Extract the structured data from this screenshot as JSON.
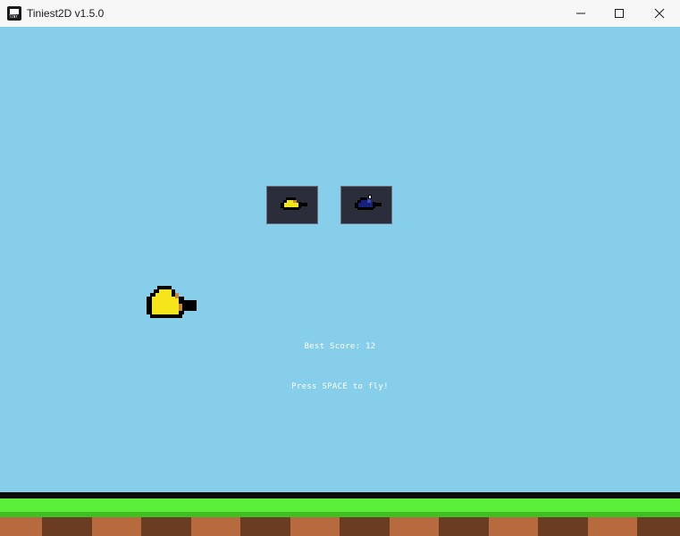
{
  "window": {
    "title": "Tiniest2D v1.5.0",
    "icon": "tiny-app-icon",
    "icon_text": "TINY",
    "controls": [
      "minimize-icon",
      "maximize-icon",
      "close-icon"
    ]
  },
  "game": {
    "best_score_label": "Best Score:",
    "best_score": 12,
    "best_score_text": "Best Score: 12",
    "instruction": "Press SPACE to fly!",
    "skins": [
      {
        "name": "yellow",
        "color": "#f7e51b",
        "selected": true
      },
      {
        "name": "blue",
        "color": "#17207a",
        "selected": false
      }
    ]
  },
  "colors": {
    "sky": "#87ceea",
    "grass": "#5bef3a",
    "dirt_light": "#b86a3f",
    "dirt_dark": "#6a3d22",
    "bird_yellow": "#f7e51b",
    "bird_blue": "#17207a",
    "skin_panel": "#2b2e3a"
  }
}
